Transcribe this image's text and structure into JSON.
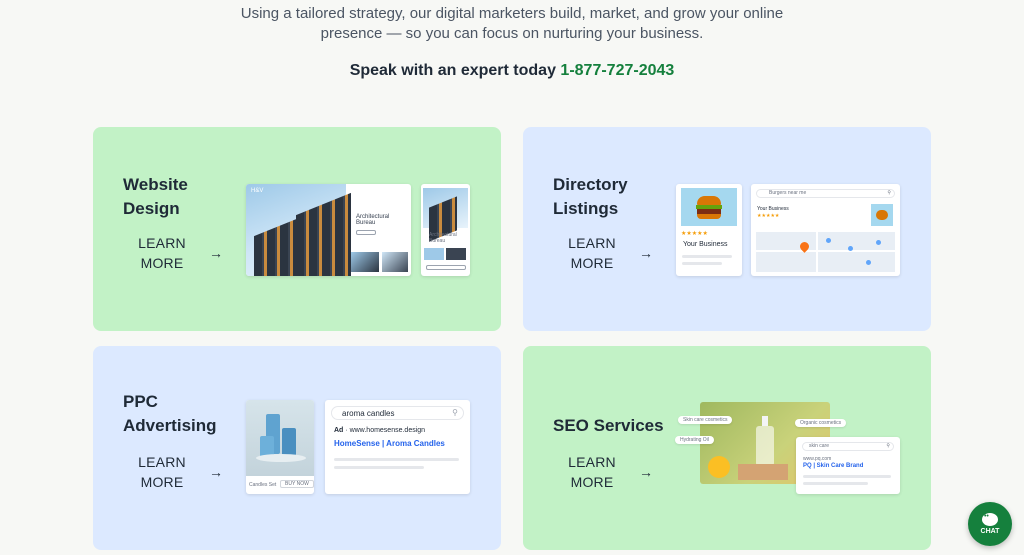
{
  "intro": {
    "line1": "Using a tailored strategy, our digital marketers build, market, and grow your online",
    "line2": "presence — so you can focus on nurturing your business."
  },
  "cta": {
    "text": "Speak with an expert today",
    "phone": "1-877-727-2043"
  },
  "learn_more": {
    "line1": "LEARN",
    "line2": "MORE",
    "arrow": "→"
  },
  "cards": {
    "website": {
      "title_line1": "Website",
      "title_line2": "Design",
      "mock": {
        "logo": "H&V",
        "heading_line1": "Architectural",
        "heading_line2": "Bureau",
        "small_heading_line1": "Architectural",
        "small_heading_line2": "Bureau"
      }
    },
    "directory": {
      "title_line1": "Directory",
      "title_line2": "Listings",
      "mock": {
        "stars": "★★★★★",
        "business": "Your Business",
        "search": "Burgers near me",
        "map_business": "Your Business"
      }
    },
    "ppc": {
      "title_line1": "PPC",
      "title_line2": "Advertising",
      "mock": {
        "caption": "Candles Set",
        "buy": "BUY NOW",
        "search": "aroma candles",
        "ad_label": "Ad",
        "ad_url": "· www.homesense.design",
        "ad_title": "HomeSense | Aroma Candles"
      }
    },
    "seo": {
      "title": "SEO Services",
      "mock": {
        "tag1": "Skin care cosmetics",
        "tag2": "Hydrating Oil",
        "tag3": "Organic cosmetics",
        "search": "skin care",
        "url": "www.pq.com",
        "result_title": "PQ | Skin Care Brand"
      }
    }
  },
  "chat": {
    "label": "CHAT"
  },
  "colors": {
    "green_card": "#c2f2c6",
    "blue_card": "#dce9ff",
    "accent": "#15803d"
  }
}
